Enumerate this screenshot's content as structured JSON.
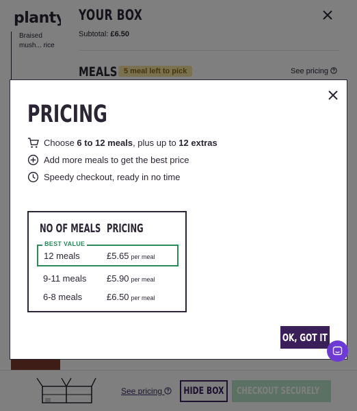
{
  "background": {
    "logo": "planty",
    "card_text": "Braised mush... rice"
  },
  "drawer": {
    "title": "YOUR BOX",
    "subtotal_label": "Subtotal:",
    "subtotal_value": "£6.50",
    "meals_heading": "MEALS",
    "meal_badge": "5 meal left to pick",
    "see_pricing": "See pricing"
  },
  "bottom_bar": {
    "see_pricing": "See pricing",
    "hide_box": "HIDE BOX",
    "checkout": "CHECKOUT SECURELY"
  },
  "modal": {
    "title": "PRICING",
    "info": [
      {
        "icon": "cart-icon",
        "pre": "Choose ",
        "bold1": "6 to 12 meals",
        "mid": ", plus up to ",
        "bold2": "12 extras"
      },
      {
        "icon": "plus-circle-icon",
        "text": "Add more meals to get the best price"
      },
      {
        "icon": "clock-icon",
        "text": "Speedy checkout, ready in no time"
      }
    ],
    "table": {
      "col_meals": "NO OF MEALS",
      "col_pricing": "PRICING",
      "best_value_label": "BEST VALUE",
      "rows": [
        {
          "meals": "12 meals",
          "price": "£5.65",
          "unit": "per meal"
        },
        {
          "meals": "9-11 meals",
          "price": "£5.90",
          "unit": "per meal"
        },
        {
          "meals": "6-8 meals",
          "price": "£6.50",
          "unit": "per meal"
        }
      ]
    },
    "ok_button": "OK, GOT IT"
  },
  "colors": {
    "brand_dark": "#3b1f59",
    "accent_green": "#2a8a5a",
    "badge_bg": "#f5e3a3",
    "chat": "#6e3ad6"
  }
}
